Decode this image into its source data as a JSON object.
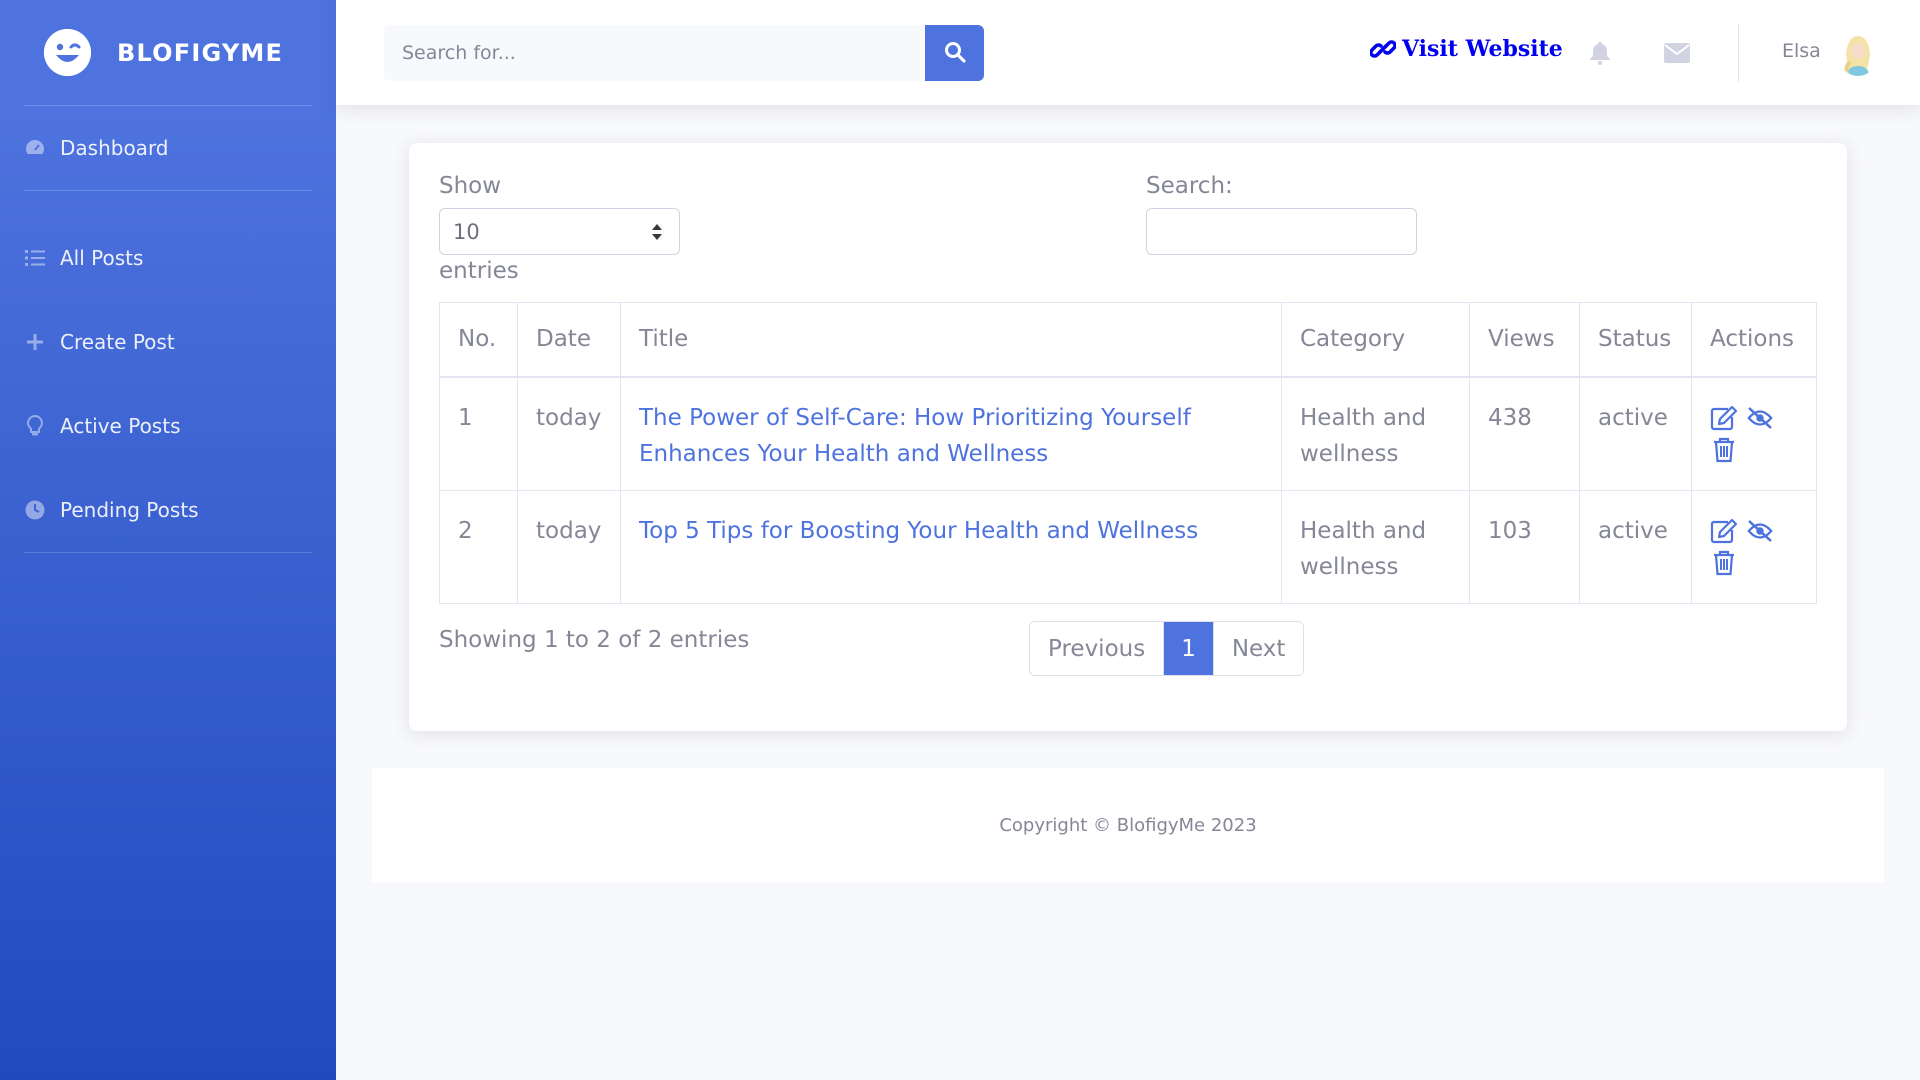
{
  "brand": {
    "name": "BLOFIGYME"
  },
  "sidebar": {
    "items": [
      {
        "label": "Dashboard",
        "icon": "tachometer-icon"
      },
      {
        "label": "All Posts",
        "icon": "list-icon"
      },
      {
        "label": "Create Post",
        "icon": "plus-icon"
      },
      {
        "label": "Active Posts",
        "icon": "lightbulb-icon"
      },
      {
        "label": "Pending Posts",
        "icon": "clock-icon"
      }
    ]
  },
  "topbar": {
    "search_placeholder": "Search for...",
    "visit_label": "Visit Website",
    "username": "Elsa"
  },
  "table_controls": {
    "show_label": "Show",
    "entries_value": "10",
    "entries_label": "entries",
    "search_label": "Search:"
  },
  "table": {
    "headers": [
      "No.",
      "Date",
      "Title",
      "Category",
      "Views",
      "Status",
      "Actions"
    ],
    "rows": [
      {
        "no": "1",
        "date": "today",
        "title": "The Power of Self-Care: How Prioritizing Yourself Enhances Your Health and Wellness",
        "category": "Health and wellness",
        "views": "438",
        "status": "active"
      },
      {
        "no": "2",
        "date": "today",
        "title": "Top 5 Tips for Boosting Your Health and Wellness",
        "category": "Health and wellness",
        "views": "103",
        "status": "active"
      }
    ]
  },
  "pagination": {
    "info": "Showing 1 to 2 of 2 entries",
    "previous": "Previous",
    "current": "1",
    "next": "Next"
  },
  "footer": {
    "copyright": "Copyright © BlofigyMe 2023"
  },
  "colors": {
    "primary": "#4e73df",
    "primary_dark": "#224abe",
    "link": "#0000ee",
    "text": "#858796"
  }
}
